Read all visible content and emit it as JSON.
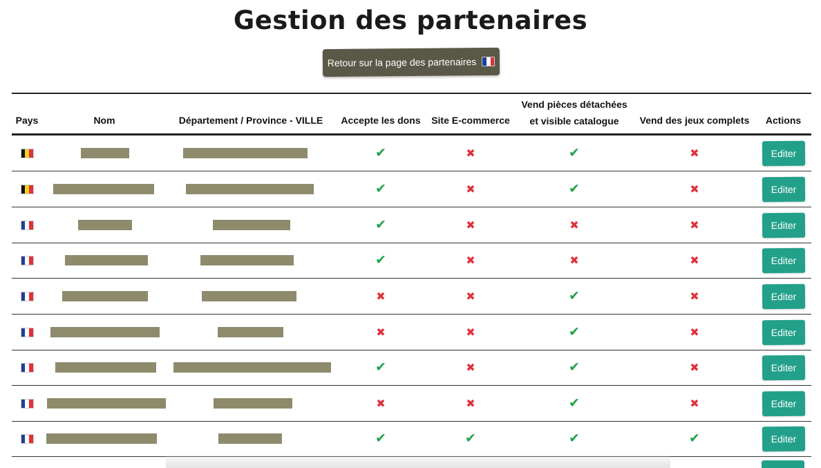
{
  "page": {
    "title": "Gestion des partenaires",
    "back_button_label": "Retour sur la page des partenaires"
  },
  "colors": {
    "accent": "#23a08a",
    "back_button": "#5a5846",
    "check": "#21a34a",
    "cross": "#e0313b"
  },
  "icons": {
    "yes": "check-icon",
    "no": "cross-icon"
  },
  "table": {
    "headers": {
      "pays": "Pays",
      "nom": "Nom",
      "departement": "Département / Province - VILLE",
      "dons": "Accepte les dons",
      "ecommerce": "Site E-commerce",
      "pieces_line1": "Vend pièces détachées",
      "pieces_line2": "et visible catalogue",
      "jeux": "Vend des jeux complets",
      "actions": "Actions"
    },
    "edit_label": "Editer",
    "rows": [
      {
        "country": "be",
        "dons": true,
        "ecommerce": false,
        "pieces": true,
        "jeux": false
      },
      {
        "country": "be",
        "dons": true,
        "ecommerce": false,
        "pieces": true,
        "jeux": false
      },
      {
        "country": "fr",
        "dons": true,
        "ecommerce": false,
        "pieces": false,
        "jeux": false
      },
      {
        "country": "fr",
        "dons": true,
        "ecommerce": false,
        "pieces": false,
        "jeux": false
      },
      {
        "country": "fr",
        "dons": false,
        "ecommerce": false,
        "pieces": true,
        "jeux": false
      },
      {
        "country": "fr",
        "dons": false,
        "ecommerce": false,
        "pieces": true,
        "jeux": false
      },
      {
        "country": "fr",
        "dons": true,
        "ecommerce": false,
        "pieces": true,
        "jeux": false
      },
      {
        "country": "fr",
        "dons": false,
        "ecommerce": false,
        "pieces": true,
        "jeux": false
      },
      {
        "country": "fr",
        "dons": true,
        "ecommerce": true,
        "pieces": true,
        "jeux": true
      }
    ]
  }
}
